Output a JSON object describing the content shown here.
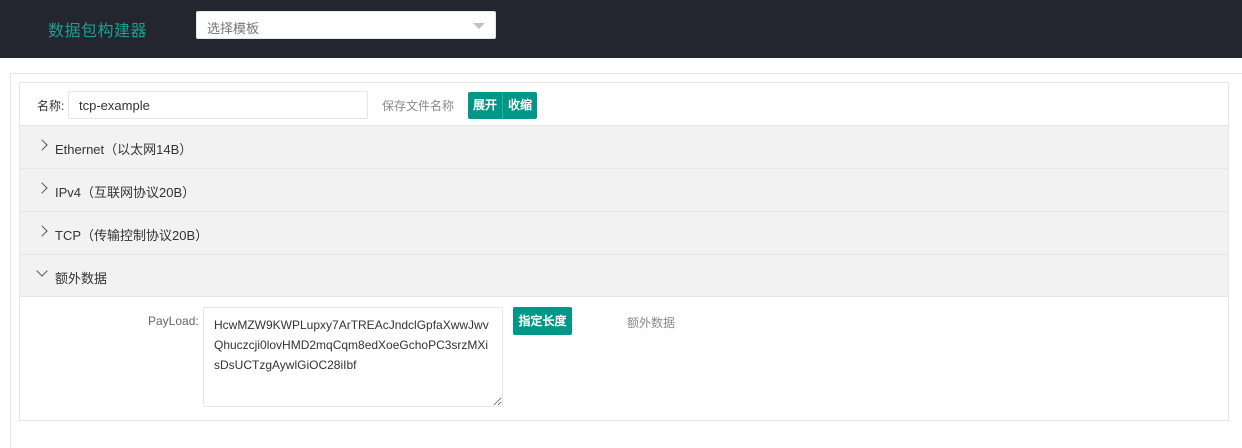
{
  "header": {
    "app_title": "数据包构建器",
    "template_select": {
      "placeholder": "选择模板",
      "icon": "chevron-down-icon"
    }
  },
  "form": {
    "name_label": "名称:",
    "name_value": "tcp-example",
    "name_hint": "保存文件名称",
    "expand_label": "展开",
    "collapse_label": "收缩"
  },
  "sections": [
    {
      "title": "Ethernet（以太网14B）",
      "expanded": false
    },
    {
      "title": "IPv4（互联网协议20B）",
      "expanded": false
    },
    {
      "title": "TCP（传输控制协议20B）",
      "expanded": false
    },
    {
      "title": "额外数据",
      "expanded": true
    }
  ],
  "payload": {
    "label": "PayLoad:",
    "value": "HcwMZW9KWPLupxy7ArTREAcJndclGpfaXwwJwvQhuczcji0lovHMD2mqCqm8edXoeGchoPC3srzMXisDsUCTzgAywlGiOC28iIbf",
    "length_button": "指定长度",
    "hint": "额外数据"
  },
  "colors": {
    "header_bg": "#23262e",
    "brand": "#1aa094",
    "button": "#009688",
    "section_bg": "#f2f2f2"
  }
}
